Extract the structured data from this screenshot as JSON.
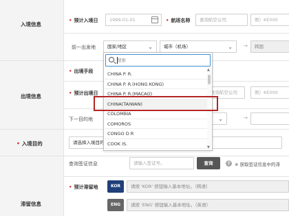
{
  "sections": {
    "entry_info": "入境信息",
    "departure_info": "出境信息",
    "entry_purpose": "入境目的",
    "stay_info": "滞留信息"
  },
  "entry": {
    "date_label": "预计入境日",
    "date_placeholder": "1999-01-01",
    "airline_label": "航班名称",
    "airline_placeholder": "查询航空公司",
    "flight_placeholder": "例）KE000",
    "prev_origin_label": "前一出发地",
    "country_select": "国家/地区",
    "city_select": "城市（机场）",
    "destination_value": "韩国"
  },
  "departure": {
    "method_label": "出境手段",
    "date_label": "预计出境日",
    "airline_placeholder": "查询航空公司",
    "flight_placeholder": "例）KE000",
    "next_dest_label": "下一目的地"
  },
  "purpose": {
    "select_placeholder": "请选择入境目的"
  },
  "visa": {
    "label": "查询签证信息",
    "input_placeholder": "请输入签证号。",
    "search_button": "查询",
    "note": "※ 获取签证信息中的滞"
  },
  "stay": {
    "address_label": "预计滞留地",
    "kor_badge": "KOR",
    "kor_placeholder": "请按 'KOR' 按钮输入基本地址。（韩语）",
    "eng_badge": "ENG",
    "eng_placeholder": "请按 'ENG' 按钮输入基本地址。（英语）"
  },
  "dropdown": {
    "search_placeholder": "搜索",
    "items": [
      "CHINA P. R.",
      "CHINA P. R.(HONG KONG)",
      "CHINA P. R.(MACAO)",
      "CHINA(TAIWAN)",
      "COLOMBIA",
      "COMOROS",
      "CONGO D R",
      "COOK IS."
    ],
    "highlighted_item": "CHINA(TAIWAN)"
  },
  "colors": {
    "required": "#d32f2f",
    "highlight_border": "#b22222",
    "kor_badge": "#1f3f7a",
    "eng_badge": "#666666",
    "search_button": "#555555"
  },
  "icons": [
    "calendar-icon",
    "chevron-down-icon",
    "arrow-right-icon",
    "search-icon",
    "help-icon"
  ]
}
